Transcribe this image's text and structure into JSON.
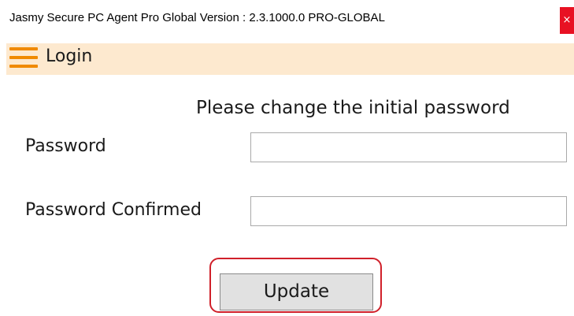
{
  "window": {
    "title": "Jasmy Secure PC Agent Pro Global Version : 2.3.1000.0 PRO-GLOBAL",
    "close_glyph": "×"
  },
  "header": {
    "menu_icon": "hamburger-menu-icon",
    "label": "Login",
    "accent_color": "#f08a00",
    "background_color": "#fde9cf"
  },
  "form": {
    "heading": "Please change the initial password",
    "password_label": "Password",
    "password_value": "",
    "password_confirmed_label": "Password Confirmed",
    "password_confirmed_value": "",
    "update_label": "Update",
    "highlight_color": "#d0202a"
  }
}
